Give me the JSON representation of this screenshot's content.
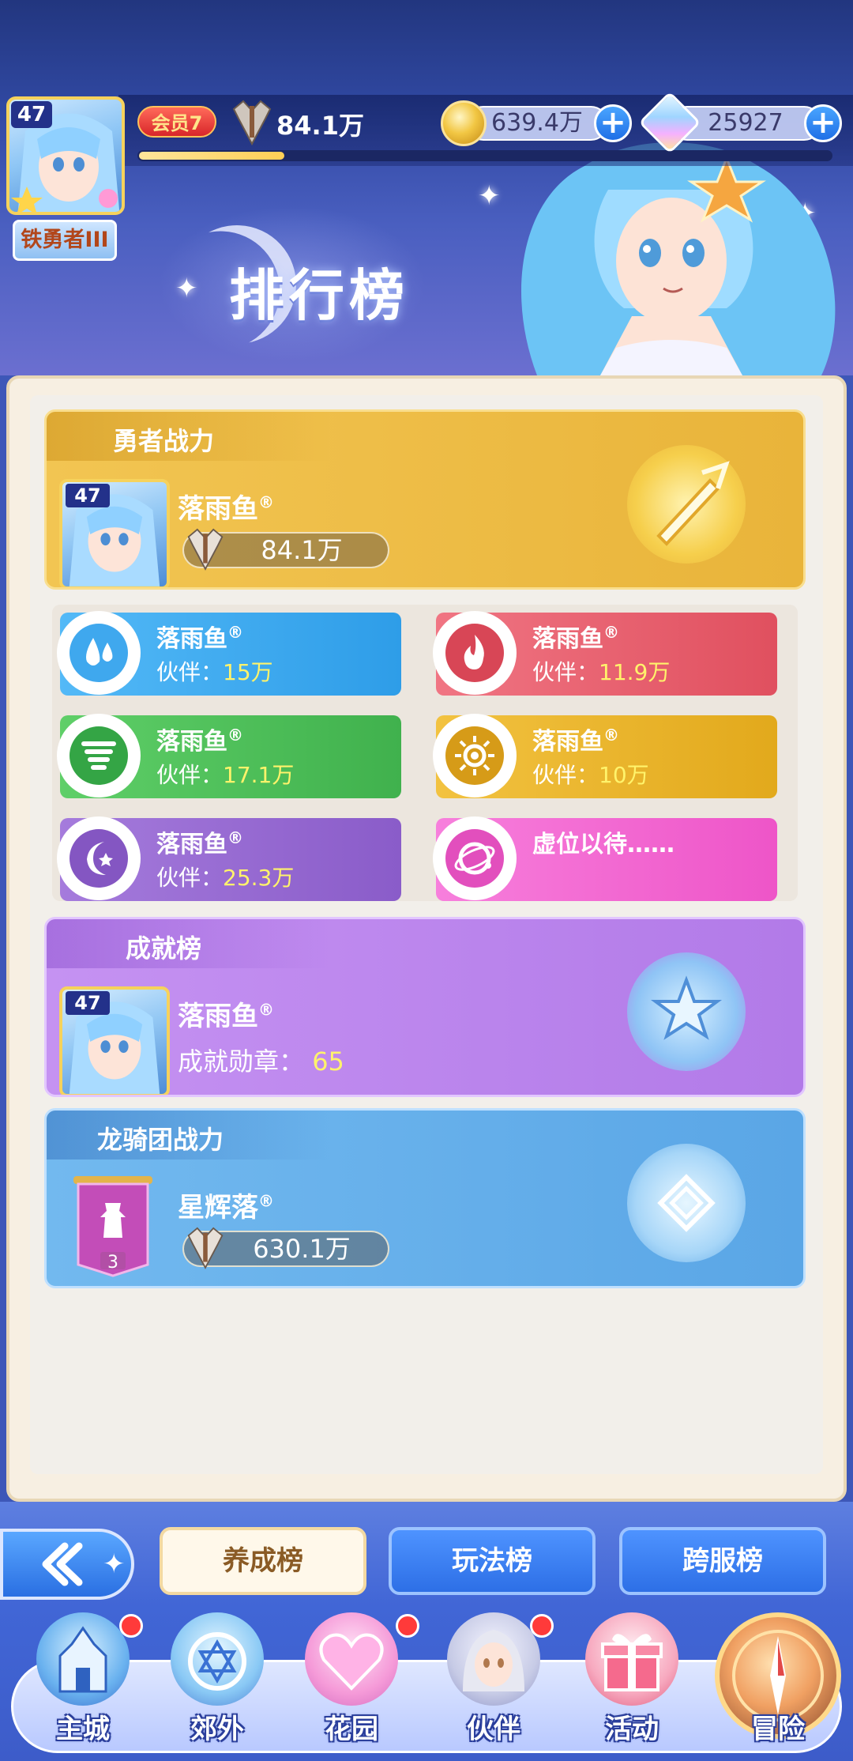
{
  "header": {
    "title": "排行榜",
    "player": {
      "level": "47",
      "rank_title": "铁勇者III",
      "vip": "会员7",
      "power": "84.1万",
      "exp_progress": 0.21
    },
    "gold": "639.4万",
    "gems": "25927"
  },
  "rankings": {
    "hero_power": {
      "title": "勇者战力",
      "player_level": "47",
      "player_name": "落雨鱼",
      "reg_mark": "®",
      "power": "84.1万"
    },
    "partners": [
      {
        "name": "落雨鱼",
        "label": "伙伴：",
        "value": "15万",
        "element": "water"
      },
      {
        "name": "落雨鱼",
        "label": "伙伴：",
        "value": "11.9万",
        "element": "fire"
      },
      {
        "name": "落雨鱼",
        "label": "伙伴：",
        "value": "17.1万",
        "element": "wind"
      },
      {
        "name": "落雨鱼",
        "label": "伙伴：",
        "value": "10万",
        "element": "light"
      },
      {
        "name": "落雨鱼",
        "label": "伙伴：",
        "value": "25.3万",
        "element": "dark"
      },
      {
        "name": "虚位以待……",
        "label": "",
        "value": "",
        "element": "star"
      }
    ],
    "achievement": {
      "title": "成就榜",
      "player_level": "47",
      "player_name": "落雨鱼",
      "reg_mark": "®",
      "label": "成就勋章：",
      "value": "65"
    },
    "dragon_knights": {
      "title": "龙骑团战力",
      "rank": "3",
      "guild_name": "星辉落",
      "reg_mark": "®",
      "power": "630.1万"
    }
  },
  "tabs": [
    "养成榜",
    "玩法榜",
    "跨服榜"
  ],
  "nav": [
    "主城",
    "郊外",
    "花园",
    "伙伴",
    "活动",
    "冒险"
  ],
  "colors": {
    "hero_card": "#f0c24a",
    "achievement_card": "#c08aef",
    "dragon_card": "#6fb4ea",
    "water": "#3fa8ee",
    "fire": "#ec5d6c",
    "wind": "#4fbf5c",
    "light": "#eab12d",
    "dark": "#9566cf",
    "star": "#f46ad3"
  }
}
